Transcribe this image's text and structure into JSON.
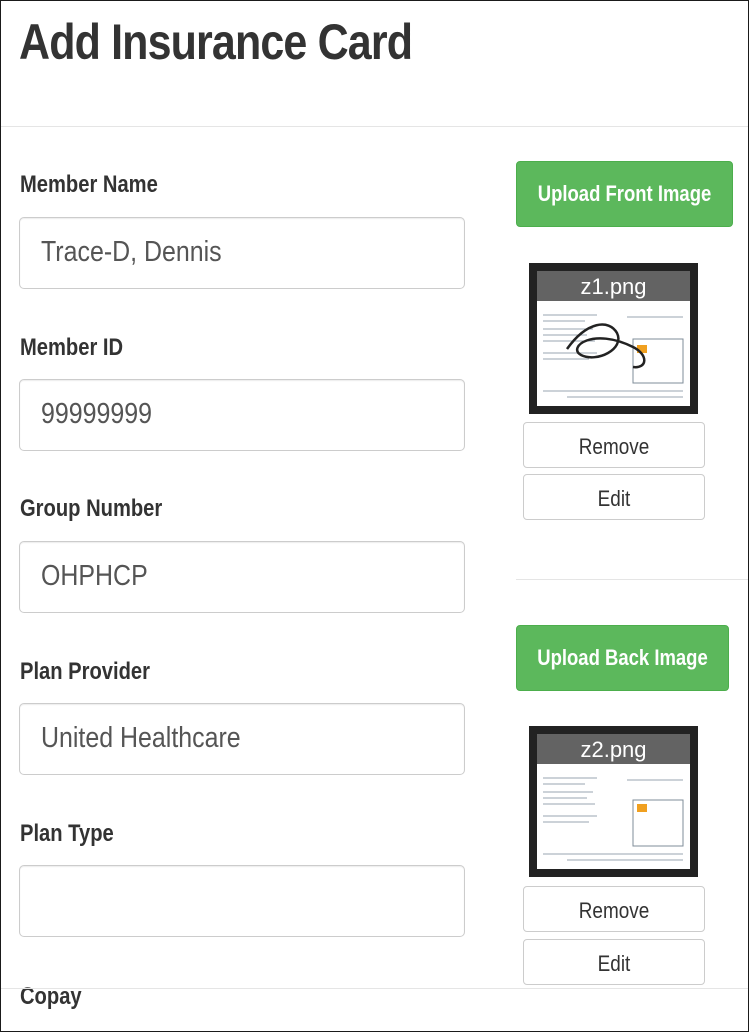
{
  "page": {
    "title": "Add Insurance Card"
  },
  "form": {
    "member_name": {
      "label": "Member Name",
      "value": "Trace-D, Dennis"
    },
    "member_id": {
      "label": "Member ID",
      "value": "99999999"
    },
    "group_number": {
      "label": "Group Number",
      "value": "OHPHCP"
    },
    "plan_provider": {
      "label": "Plan Provider",
      "value": "United Healthcare"
    },
    "plan_type": {
      "label": "Plan Type",
      "value": ""
    },
    "copay": {
      "label": "Copay"
    }
  },
  "front_image": {
    "upload_label": "Upload Front Image",
    "filename": "z1.png",
    "remove_label": "Remove",
    "edit_label": "Edit"
  },
  "back_image": {
    "upload_label": "Upload Back Image",
    "filename": "z2.png",
    "remove_label": "Remove",
    "edit_label": "Edit"
  },
  "colors": {
    "success": "#5cb85c",
    "text": "#333333",
    "input_text": "#555555",
    "border": "#cccccc"
  }
}
